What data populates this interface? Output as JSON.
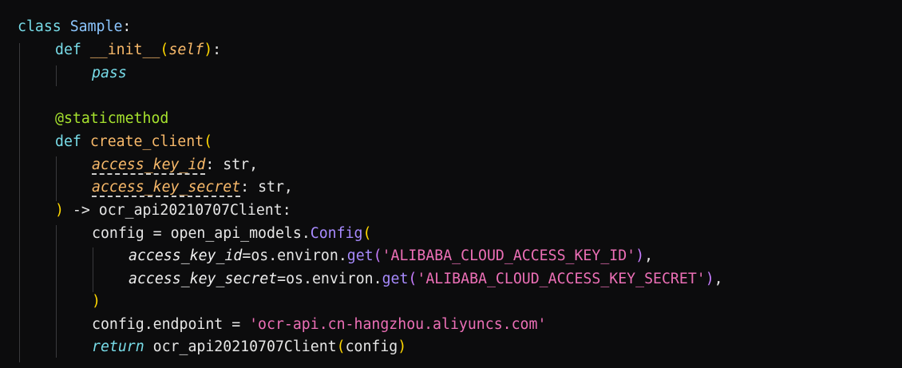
{
  "code": {
    "line1": {
      "kw": "class",
      "name": "Sample",
      "colon": ":"
    },
    "line2": {
      "kw": "def",
      "name": "__init__",
      "open": "(",
      "self": "self",
      "close": ")",
      "colon": ":"
    },
    "line3": {
      "kw": "pass"
    },
    "line5": {
      "decorator": "@staticmethod"
    },
    "line6": {
      "kw": "def",
      "name": "create_client",
      "open": "("
    },
    "line7": {
      "param": "access_key_id",
      "sep": ": ",
      "type": "str",
      "comma": ","
    },
    "line8": {
      "param": "access_key_secret",
      "sep": ": ",
      "type": "str",
      "comma": ","
    },
    "line9": {
      "close": ")",
      "arrow": " -> ",
      "ret": "ocr_api20210707Client",
      "colon": ":"
    },
    "line10": {
      "var": "config",
      "eq": " = ",
      "mod": "open_api_models",
      "dot": ".",
      "cls": "Config",
      "open": "("
    },
    "line11": {
      "arg": "access_key_id",
      "eq": "=",
      "obj": "os.environ",
      "dot": ".",
      "fn": "get",
      "open": "(",
      "str": "'ALIBABA_CLOUD_ACCESS_KEY_ID'",
      "close": ")",
      "comma": ","
    },
    "line12": {
      "arg": "access_key_secret",
      "eq": "=",
      "obj": "os.environ",
      "dot": ".",
      "fn": "get",
      "open": "(",
      "str": "'ALIBABA_CLOUD_ACCESS_KEY_SECRET'",
      "close": ")",
      "comma": ","
    },
    "line13": {
      "close": ")"
    },
    "line14": {
      "var": "config.endpoint",
      "eq": " = ",
      "str": "'ocr-api.cn-hangzhou.aliyuncs.com'"
    },
    "line15": {
      "kw": "return",
      "sp": " ",
      "cls": "ocr_api20210707Client",
      "open": "(",
      "arg": "config",
      "close": ")"
    }
  },
  "colors": {
    "background": "#0c0c0d",
    "keyword": "#78dce8",
    "function": "#f8b96a",
    "string": "#ec6fb6",
    "decorator": "#a6e22e",
    "bracket": "#ffd700"
  }
}
